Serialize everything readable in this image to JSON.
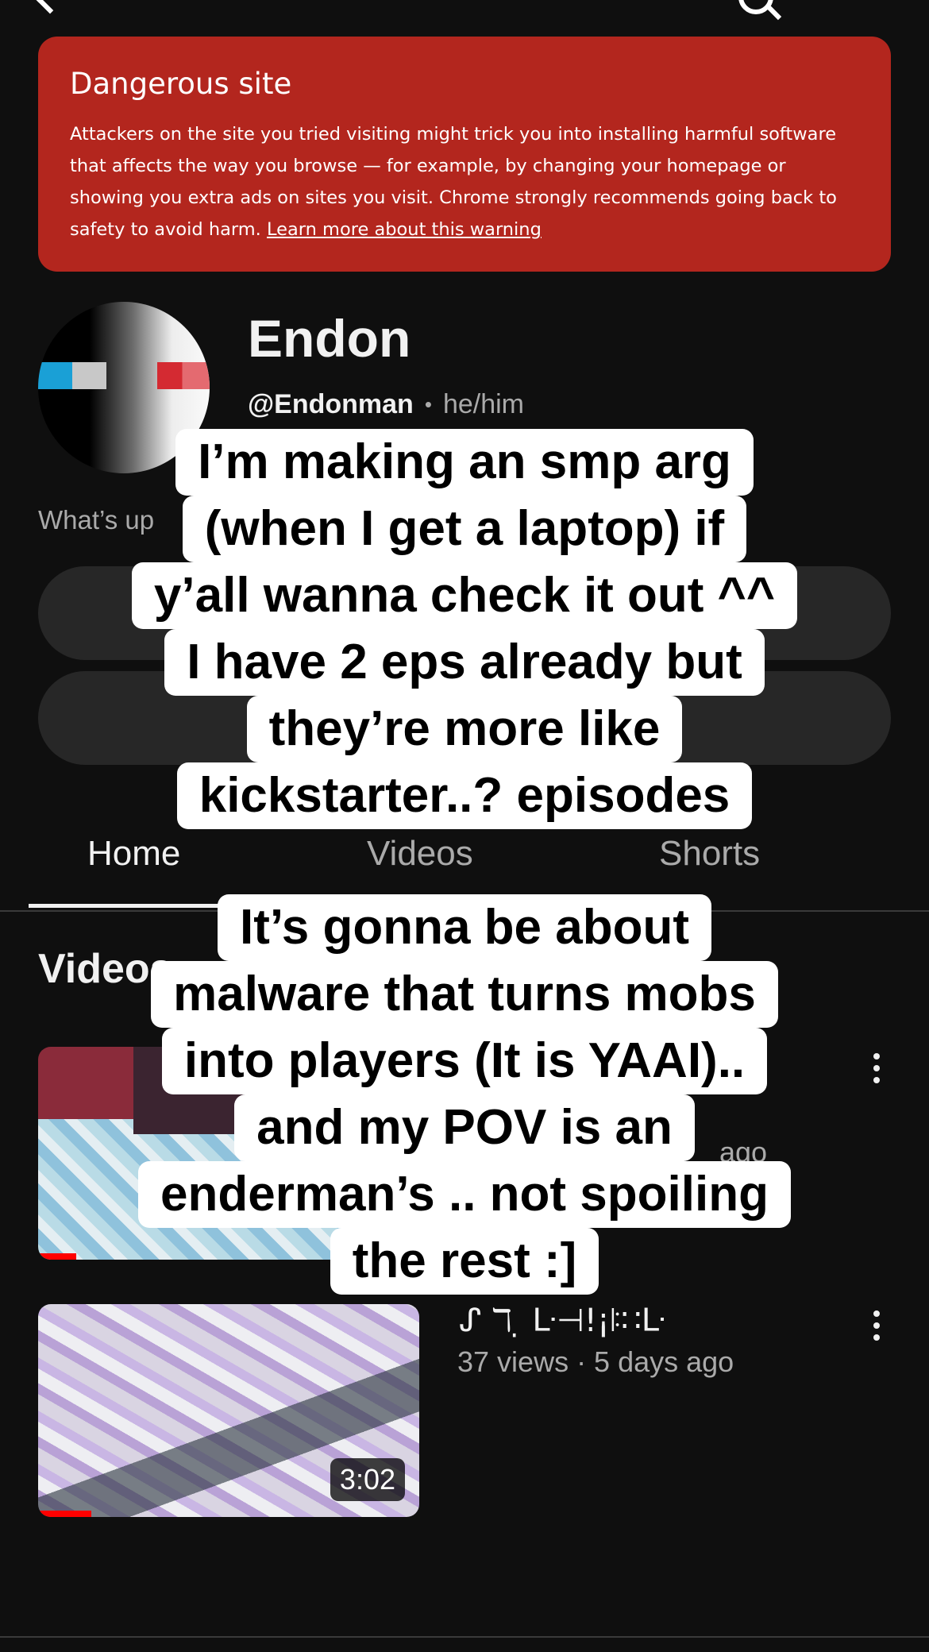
{
  "warning": {
    "title": "Dangerous site",
    "body": "Attackers on the site you tried visiting might trick you into installing harmful software that affects the way you browse — for example, by changing your homepage or showing you extra ads on sites you visit. Chrome strongly recommends going back to safety to avoid harm.",
    "link": "Learn more about this warning"
  },
  "channel": {
    "name": "Endon",
    "handle": "@Endonman",
    "separator": "•",
    "pronouns": "he/him",
    "description": "What’s up"
  },
  "tabs": [
    {
      "label": "Home",
      "active": true
    },
    {
      "label": "Videos",
      "active": false
    },
    {
      "label": "Shorts",
      "active": false
    }
  ],
  "section": {
    "title": "Videos"
  },
  "videos": [
    {
      "meta_partial": "ago",
      "progress_fraction": 0.1
    },
    {
      "title": "ᔑ ℸ ̣ ᒷ⊣!¡ꖎ∷ᒷ",
      "meta": "37 views · 5 days ago",
      "duration": "3:02",
      "progress_fraction": 0.14
    }
  ],
  "overlay": {
    "caption1": [
      "I’m making an smp arg",
      "(when I get a laptop) if",
      "y’all wanna check it out ^^",
      "I have 2 eps already but",
      "they’re more like",
      "kickstarter..? episodes"
    ],
    "caption2": [
      "It’s gonna be about",
      "malware that turns mobs",
      "into players (It is YAAI)..",
      "and my POV is an",
      "enderman’s .. not spoiling",
      "the rest :]"
    ]
  },
  "colors": {
    "background": "#0f0f0f",
    "warning": "#b3261e",
    "pill": "#272727",
    "progress": "#ff0000"
  }
}
